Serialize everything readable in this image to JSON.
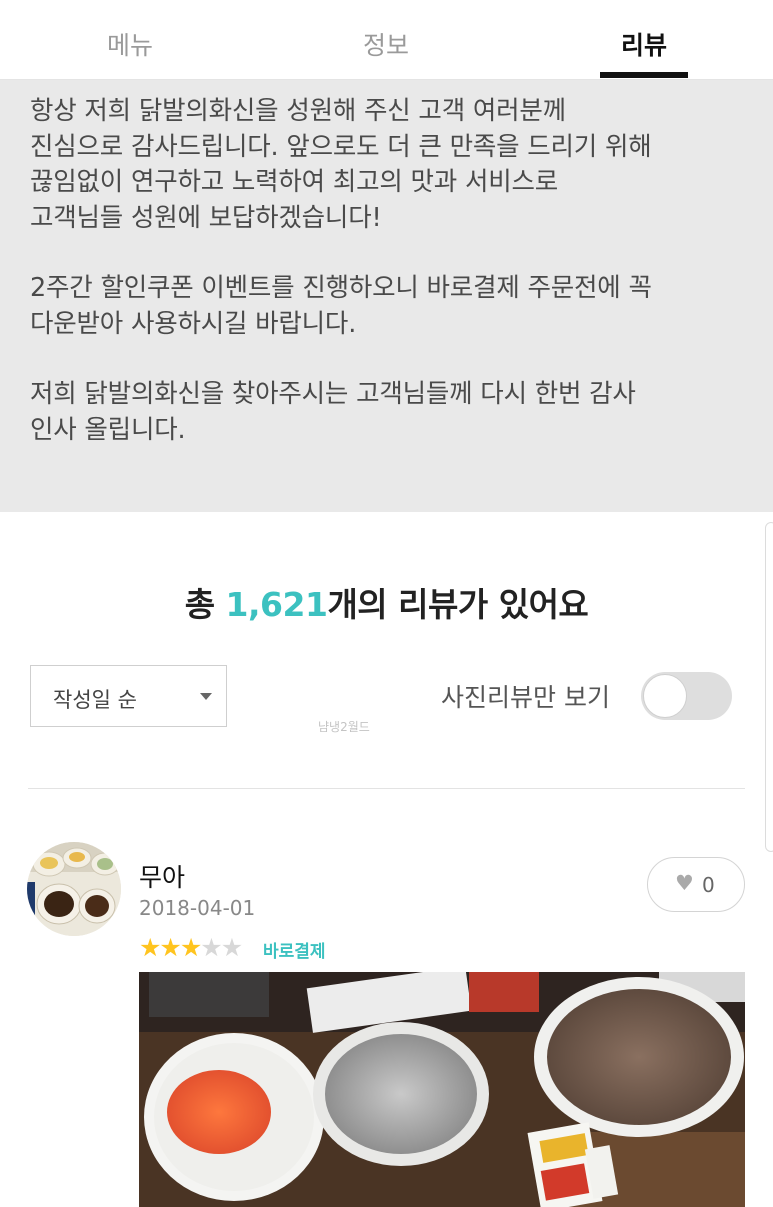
{
  "tabs": [
    {
      "label": "메뉴"
    },
    {
      "label": "정보"
    },
    {
      "label": "리뷰",
      "active": true
    }
  ],
  "notice": {
    "paragraphs": [
      "항상 저희 닭발의화신을 성원해 주신 고객 여러분께\n진심으로 감사드립니다. 앞으로도 더 큰 만족을 드리기 위해\n끊임없이 연구하고 노력하여 최고의 맛과 서비스로\n고객님들 성원에 보답하겠습니다!",
      "2주간 할인쿠폰 이벤트를 진행하오니 바로결제 주문전에 꼭\n다운받아 사용하시길 바랍니다.",
      "저희 닭발의화신을 찾아주시는 고객님들께 다시 한번 감사\n인사 올립니다."
    ]
  },
  "summary": {
    "prefix": "총 ",
    "count": "1,621",
    "suffix": "개의 리뷰가 있어요"
  },
  "controls": {
    "sort_label": "작성일 순",
    "photo_only_label": "사진리뷰만 보기",
    "photo_only_on": false,
    "watermark": "냠냉2월드"
  },
  "review": {
    "author": "무아",
    "date": "2018-04-01",
    "rating": 3,
    "rating_max": 5,
    "order_type": "바로결제",
    "likes": "0"
  },
  "icons": {
    "like": "heart-icon",
    "sort": "caret-down-icon",
    "rating": "star-icon"
  },
  "colors": {
    "accent": "#3cc1c0",
    "star": "#ffc41f",
    "notice_bg": "#e9e9e9"
  }
}
